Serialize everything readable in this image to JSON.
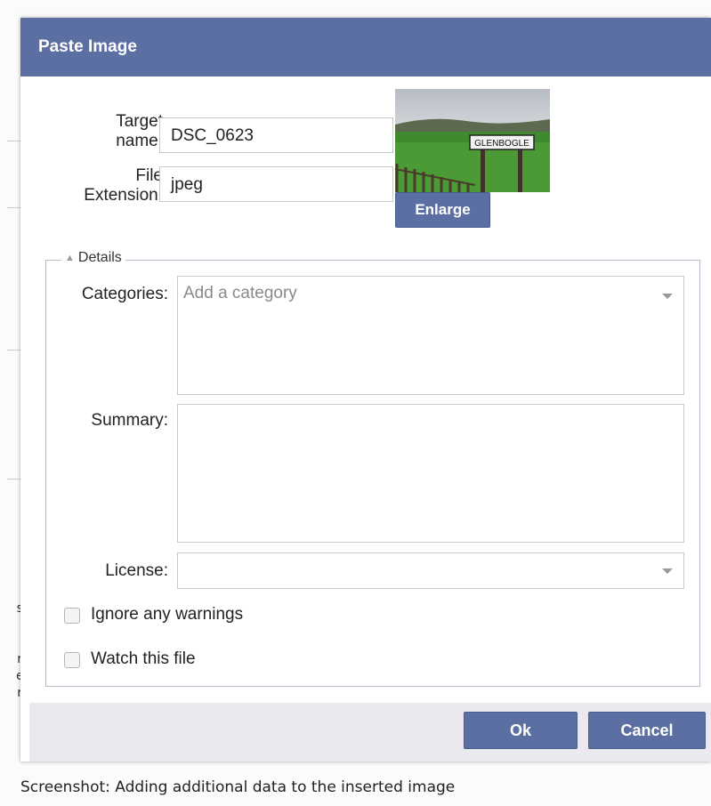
{
  "dialog": {
    "title": "Paste Image"
  },
  "form": {
    "target_name_label_line1": "Target",
    "target_name_label_line2": "name:",
    "target_name_value": "DSC_0623",
    "file_ext_label_line1": "File",
    "file_ext_label_line2": "Extension:",
    "file_ext_value": "jpeg",
    "thumbnail_sign_text": "GLENBOGLE",
    "enlarge_label": "Enlarge"
  },
  "details": {
    "legend": "Details",
    "categories_label": "Categories:",
    "categories_placeholder": "Add a category",
    "summary_label": "Summary:",
    "license_label": "License:",
    "ignore_warnings_label": "Ignore any warnings",
    "watch_file_label": "Watch this file"
  },
  "footer": {
    "ok_label": "Ok",
    "cancel_label": "Cancel"
  },
  "caption": "Screenshot: Adding additional data to the inserted image",
  "background_text": [
    "s",
    "r",
    "e",
    "r"
  ],
  "colors": {
    "titlebar": "#5b6fa3",
    "button": "#5b6fa3",
    "footer": "#e9e9ee"
  },
  "icons": [
    "triangle-up-icon",
    "chevron-down-icon"
  ]
}
